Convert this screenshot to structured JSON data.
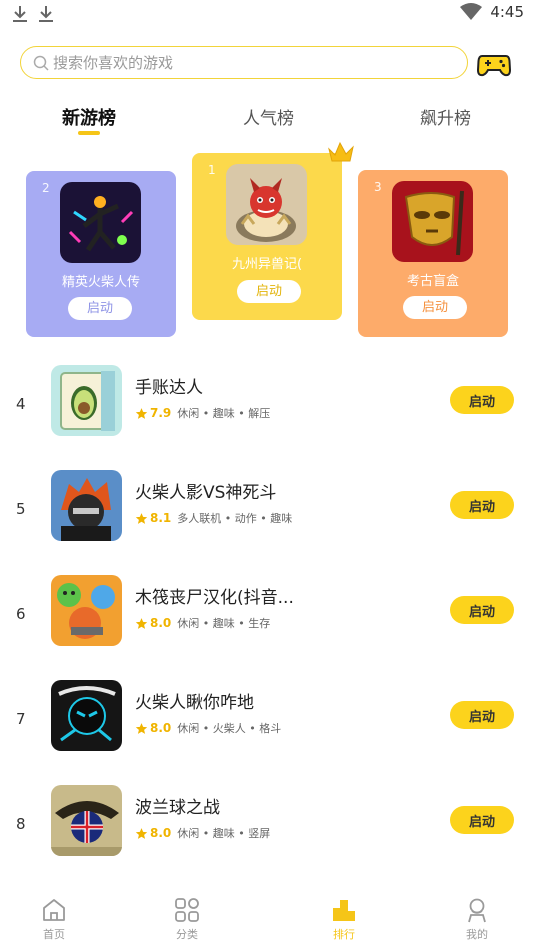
{
  "status_bar": {
    "time": "4:45"
  },
  "search": {
    "placeholder": "搜索你喜欢的游戏"
  },
  "tabs": [
    {
      "label": "新游榜",
      "active": true
    },
    {
      "label": "人气榜",
      "active": false
    },
    {
      "label": "飙升榜",
      "active": false
    }
  ],
  "podium": [
    {
      "rank": "2",
      "name": "精英火柴人传",
      "button": "启动",
      "color": "#a7abf3"
    },
    {
      "rank": "1",
      "name": "九州异兽记(",
      "button": "启动",
      "color": "#fcd94b"
    },
    {
      "rank": "3",
      "name": "考古盲盒",
      "button": "启动",
      "color": "#fdab6a"
    }
  ],
  "list": [
    {
      "rank": "4",
      "title": "手账达人",
      "score": "7.9",
      "tags": "休闲 • 趣味 • 解压",
      "button": "启动"
    },
    {
      "rank": "5",
      "title": "火柴人影VS神死斗",
      "score": "8.1",
      "tags": "多人联机 • 动作 • 趣味",
      "button": "启动"
    },
    {
      "rank": "6",
      "title": "木筏丧尸汉化(抖音...",
      "score": "8.0",
      "tags": "休闲 • 趣味 • 生存",
      "button": "启动"
    },
    {
      "rank": "7",
      "title": "火柴人瞅你咋地",
      "score": "8.0",
      "tags": "休闲 • 火柴人 • 格斗",
      "button": "启动"
    },
    {
      "rank": "8",
      "title": "波兰球之战",
      "score": "8.0",
      "tags": "休闲 • 趣味 • 竖屏",
      "button": "启动"
    }
  ],
  "bottom_nav": [
    {
      "label": "首页",
      "icon": "home-icon",
      "active": false
    },
    {
      "label": "分类",
      "icon": "grid-icon",
      "active": false
    },
    {
      "label": "排行",
      "icon": "ranking-icon",
      "active": true
    },
    {
      "label": "我的",
      "icon": "profile-icon",
      "active": false
    }
  ],
  "colors": {
    "accent": "#fcd31c",
    "star": "#f0b400"
  }
}
